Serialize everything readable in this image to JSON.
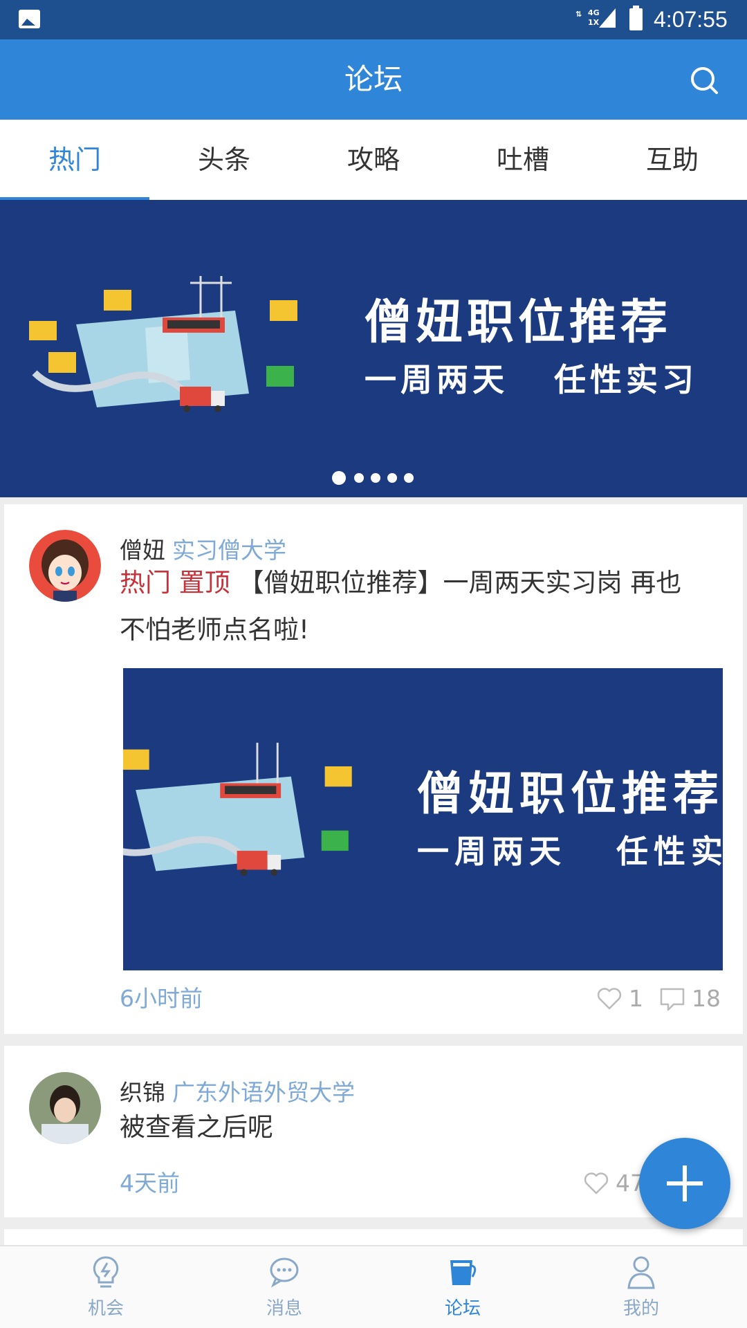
{
  "status_bar": {
    "network": "4G\n1X",
    "time": "4:07:55"
  },
  "app_bar": {
    "title": "论坛",
    "search_icon": "search-icon"
  },
  "tabs": [
    {
      "label": "热门",
      "active": true
    },
    {
      "label": "头条",
      "active": false
    },
    {
      "label": "攻略",
      "active": false
    },
    {
      "label": "吐槽",
      "active": false
    },
    {
      "label": "互助",
      "active": false
    }
  ],
  "banner": {
    "headline": "僧妞职位推荐",
    "subline": "一周两天   任性实习",
    "dots_total": 5,
    "active_dot": 1
  },
  "posts": [
    {
      "author": "僧妞",
      "school": "实习僧大学",
      "tags": [
        "热门",
        "置顶"
      ],
      "text": "【僧妞职位推荐】一周两天实习岗 再也不怕老师点名啦!",
      "image": {
        "headline": "僧妞职位推荐",
        "subline": "一周两天   任性实习"
      },
      "time": "6小时前",
      "likes": "1",
      "comments": "18"
    },
    {
      "author": "织锦",
      "school": "广东外语外贸大学",
      "text": "被查看之后呢",
      "time": "4天前",
      "likes": "47"
    }
  ],
  "fab": {
    "icon": "plus-icon"
  },
  "bottom_nav": [
    {
      "label": "机会",
      "icon": "lightbulb-icon",
      "active": false
    },
    {
      "label": "消息",
      "icon": "chat-bubble-icon",
      "active": false
    },
    {
      "label": "论坛",
      "icon": "cup-icon",
      "active": true
    },
    {
      "label": "我的",
      "icon": "person-icon",
      "active": false
    }
  ],
  "colors": {
    "primary": "#2f86d9",
    "status_bar": "#1e4f8f",
    "banner_bg": "#1c3a7f",
    "tag_red": "#c8313a",
    "secondary_text": "#7fa9d6"
  }
}
